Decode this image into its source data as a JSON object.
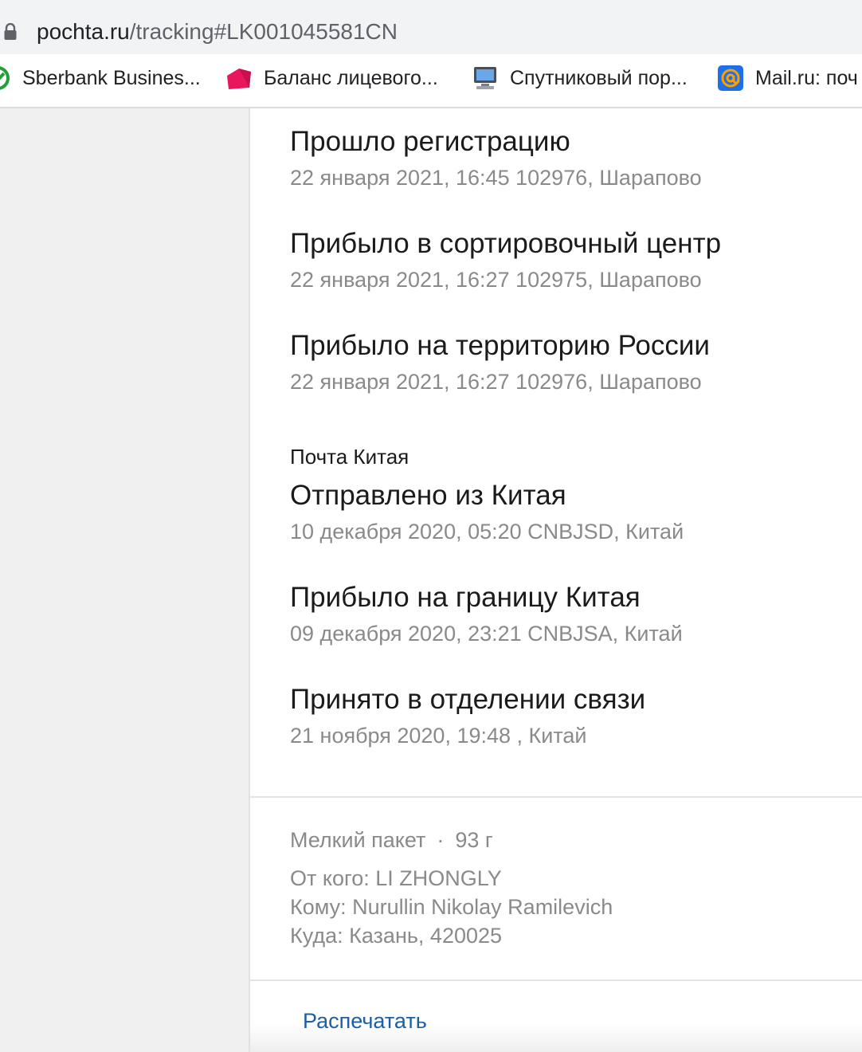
{
  "browser": {
    "url_host": "pochta.ru",
    "url_path": "/tracking#LK001045581CN",
    "bookmarks": [
      {
        "label": "Sberbank Busines...",
        "icon": "sberbank-icon"
      },
      {
        "label": "Баланс лицевого...",
        "icon": "pink-house-icon"
      },
      {
        "label": "Спутниковый пор...",
        "icon": "computer-icon"
      },
      {
        "label": "Mail.ru: поч",
        "icon": "mail-at-icon"
      }
    ]
  },
  "tracking": {
    "russia_events": [
      {
        "title": "Прошло регистрацию",
        "meta": "22 января 2021, 16:45 102976, Шарапово"
      },
      {
        "title": "Прибыло в сортировочный центр",
        "meta": "22 января 2021, 16:27 102975, Шарапово"
      },
      {
        "title": "Прибыло на территорию России",
        "meta": "22 января 2021, 16:27 102976, Шарапово"
      }
    ],
    "china_label": "Почта Китая",
    "china_events": [
      {
        "title": "Отправлено из Китая",
        "meta": "10 декабря 2020, 05:20 CNBJSD, Китай"
      },
      {
        "title": "Прибыло на границу Китая",
        "meta": "09 декабря 2020, 23:21 CNBJSA, Китай"
      },
      {
        "title": "Принято в отделении связи",
        "meta": "21 ноября 2020, 19:48 , Китай"
      }
    ]
  },
  "details": {
    "package_type": "Мелкий пакет",
    "separator": "·",
    "weight": "93 г",
    "from": "От кого: LI ZHONGLY",
    "to": "Кому: Nurullin Nikolay Ramilevich",
    "where": "Куда: Казань, 420025"
  },
  "actions": {
    "print_label": "Распечатать"
  },
  "colors": {
    "link": "#1a5fa8",
    "muted_text": "#8a8a8a",
    "primary_text": "#1b1b1b"
  }
}
